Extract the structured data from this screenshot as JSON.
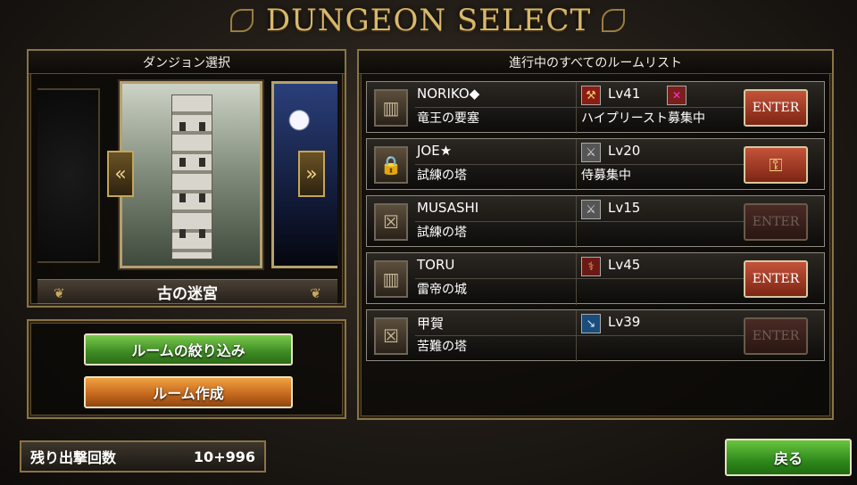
{
  "header": {
    "title": "DUNGEON SELECT"
  },
  "dungeon_panel": {
    "header": "ダンジョン選択",
    "selected_dungeon": "古の迷宮",
    "prev_label": "«",
    "next_label": "»"
  },
  "actions": {
    "filter_label": "ルームの絞り込み",
    "create_label": "ルーム作成"
  },
  "room_panel": {
    "header": "進行中のすべてのルームリスト",
    "rooms": [
      {
        "host": "NORIKO◆",
        "dungeon": "竜王の要塞",
        "level": "Lv41",
        "recruit": "ハイプリースト募集中",
        "weapon_icon": "axe-icon",
        "icon": "door-icon",
        "action": "ENTER",
        "enabled": true
      },
      {
        "host": "JOE★",
        "dungeon": "試練の塔",
        "level": "Lv20",
        "recruit": "侍募集中",
        "weapon_icon": "sword-icon",
        "icon": "padlock-icon",
        "action": "key",
        "enabled": true
      },
      {
        "host": "MUSASHI",
        "dungeon": "試練の塔",
        "level": "Lv15",
        "recruit": "",
        "weapon_icon": "sword-icon",
        "icon": "sealed-door-icon",
        "action": "ENTER",
        "enabled": false
      },
      {
        "host": "TORU",
        "dungeon": "雷帝の城",
        "level": "Lv45",
        "recruit": "",
        "weapon_icon": "mace-icon",
        "icon": "door-icon",
        "action": "ENTER",
        "enabled": true
      },
      {
        "host": "甲賀",
        "dungeon": "苦難の塔",
        "level": "Lv39",
        "recruit": "",
        "weapon_icon": "dagger-icon",
        "icon": "sealed-door-icon",
        "action": "ENTER",
        "enabled": false
      }
    ]
  },
  "footer": {
    "sortie_label": "残り出撃回数",
    "sortie_value": "10+996",
    "back_label": "戻る"
  }
}
